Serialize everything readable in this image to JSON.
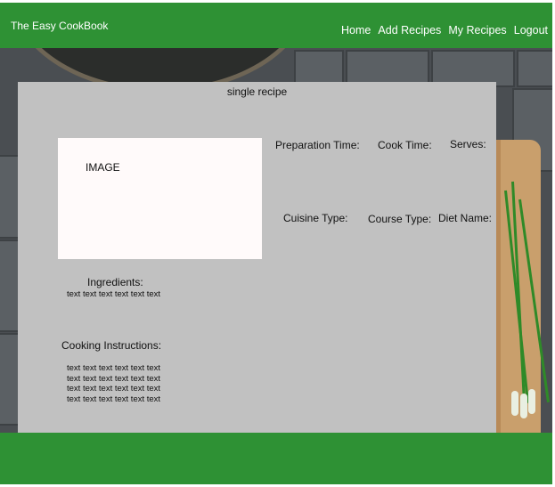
{
  "navbar": {
    "brand": "The Easy CookBook",
    "links": [
      {
        "label": "Home"
      },
      {
        "label": "Add Recipes"
      },
      {
        "label": "My Recipes"
      },
      {
        "label": "Logout"
      }
    ]
  },
  "recipe": {
    "title": "single recipe",
    "image_placeholder": "IMAGE",
    "preparation_time_label": "Preparation Time:",
    "cook_time_label": "Cook Time:",
    "serves_label": "Serves:",
    "cuisine_type_label": "Cuisine Type:",
    "course_type_label": "Course Type:",
    "diet_name_label": "Diet Name:",
    "ingredients_label": "Ingredients:",
    "ingredients_text": "text text text text text text",
    "instructions_label": "Cooking Instructions:",
    "instructions_lines": [
      "text text text text text text",
      "text text text text text text",
      "text text text text text text",
      "text text text text text text"
    ]
  },
  "colors": {
    "nav_green": "#2e9134",
    "card_gray": "#c1c1c1",
    "image_bg": "#fffafa"
  }
}
